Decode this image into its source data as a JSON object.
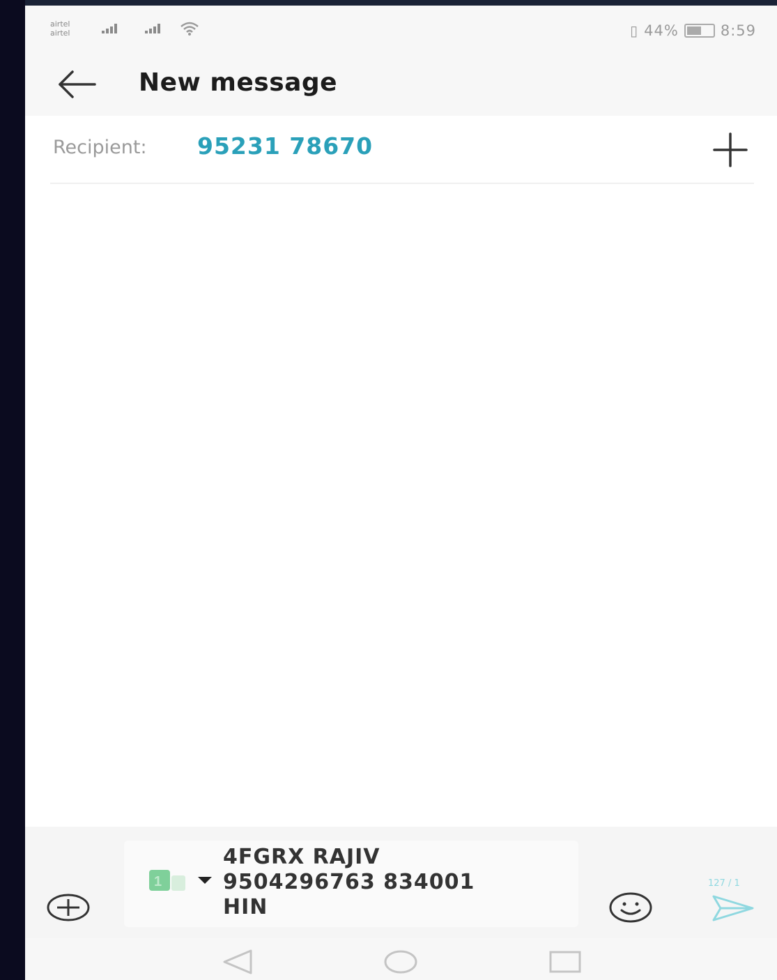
{
  "status_bar": {
    "carrier_1": "airtel",
    "carrier_2": "airtel",
    "battery": "44%",
    "time": "8:59"
  },
  "app_bar": {
    "back_icon": "arrow-left-icon",
    "title": "New message"
  },
  "recipient": {
    "label": "Recipient:",
    "value": "95231 78670",
    "add_icon": "plus-icon"
  },
  "composer": {
    "attach_icon": "circle-plus-icon",
    "sim_icon": "sim-card-icon",
    "dropdown_icon": "caret-down-icon",
    "message_lines": [
      "4FGRX RAJIV",
      "9504296763 834001",
      "HIN"
    ],
    "emoji_icon": "smiley-icon",
    "counter": "127 / 1",
    "send_icon": "send-icon"
  },
  "nav": {
    "back_icon": "nav-back-triangle-icon",
    "home_icon": "nav-home-circle-icon",
    "recents_icon": "nav-recents-square-icon"
  },
  "colors": {
    "accent": "#2aa0b9",
    "send": "#8fd8e0",
    "sim": "#7fd09a"
  }
}
